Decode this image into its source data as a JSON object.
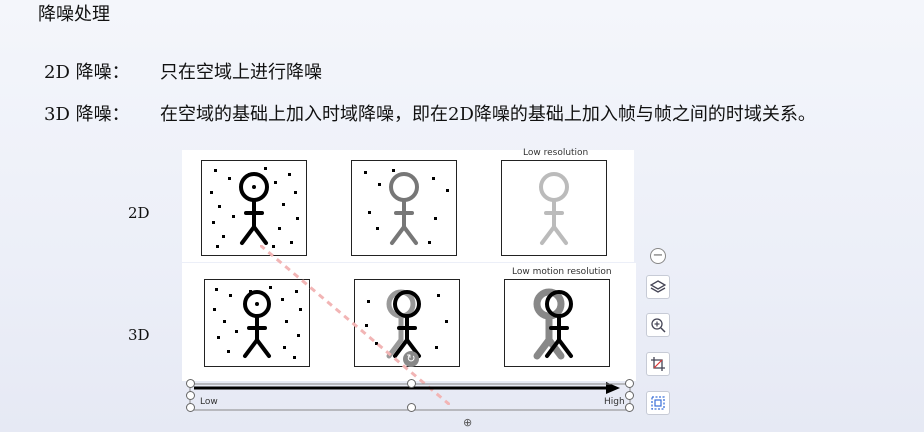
{
  "document": {
    "heading": "降噪处理",
    "line1": {
      "label": "2D 降噪：",
      "text": "只在空域上进行降噪"
    },
    "line2": {
      "label": "3D 降噪：",
      "text": "在空域的基础上加入时域降噪，即在2D降噪的基础上加入帧与帧之间的时域关系。"
    },
    "row_label_2d": "2D",
    "row_label_3d": "3D"
  },
  "figure": {
    "caption_top_right": "Low resolution",
    "caption_bottom_right": "Low motion resolution",
    "axis_low": "Low",
    "axis_high": "High"
  },
  "toolbar": {
    "collapse_glyph": "−",
    "anchor_glyph": "⊕"
  }
}
